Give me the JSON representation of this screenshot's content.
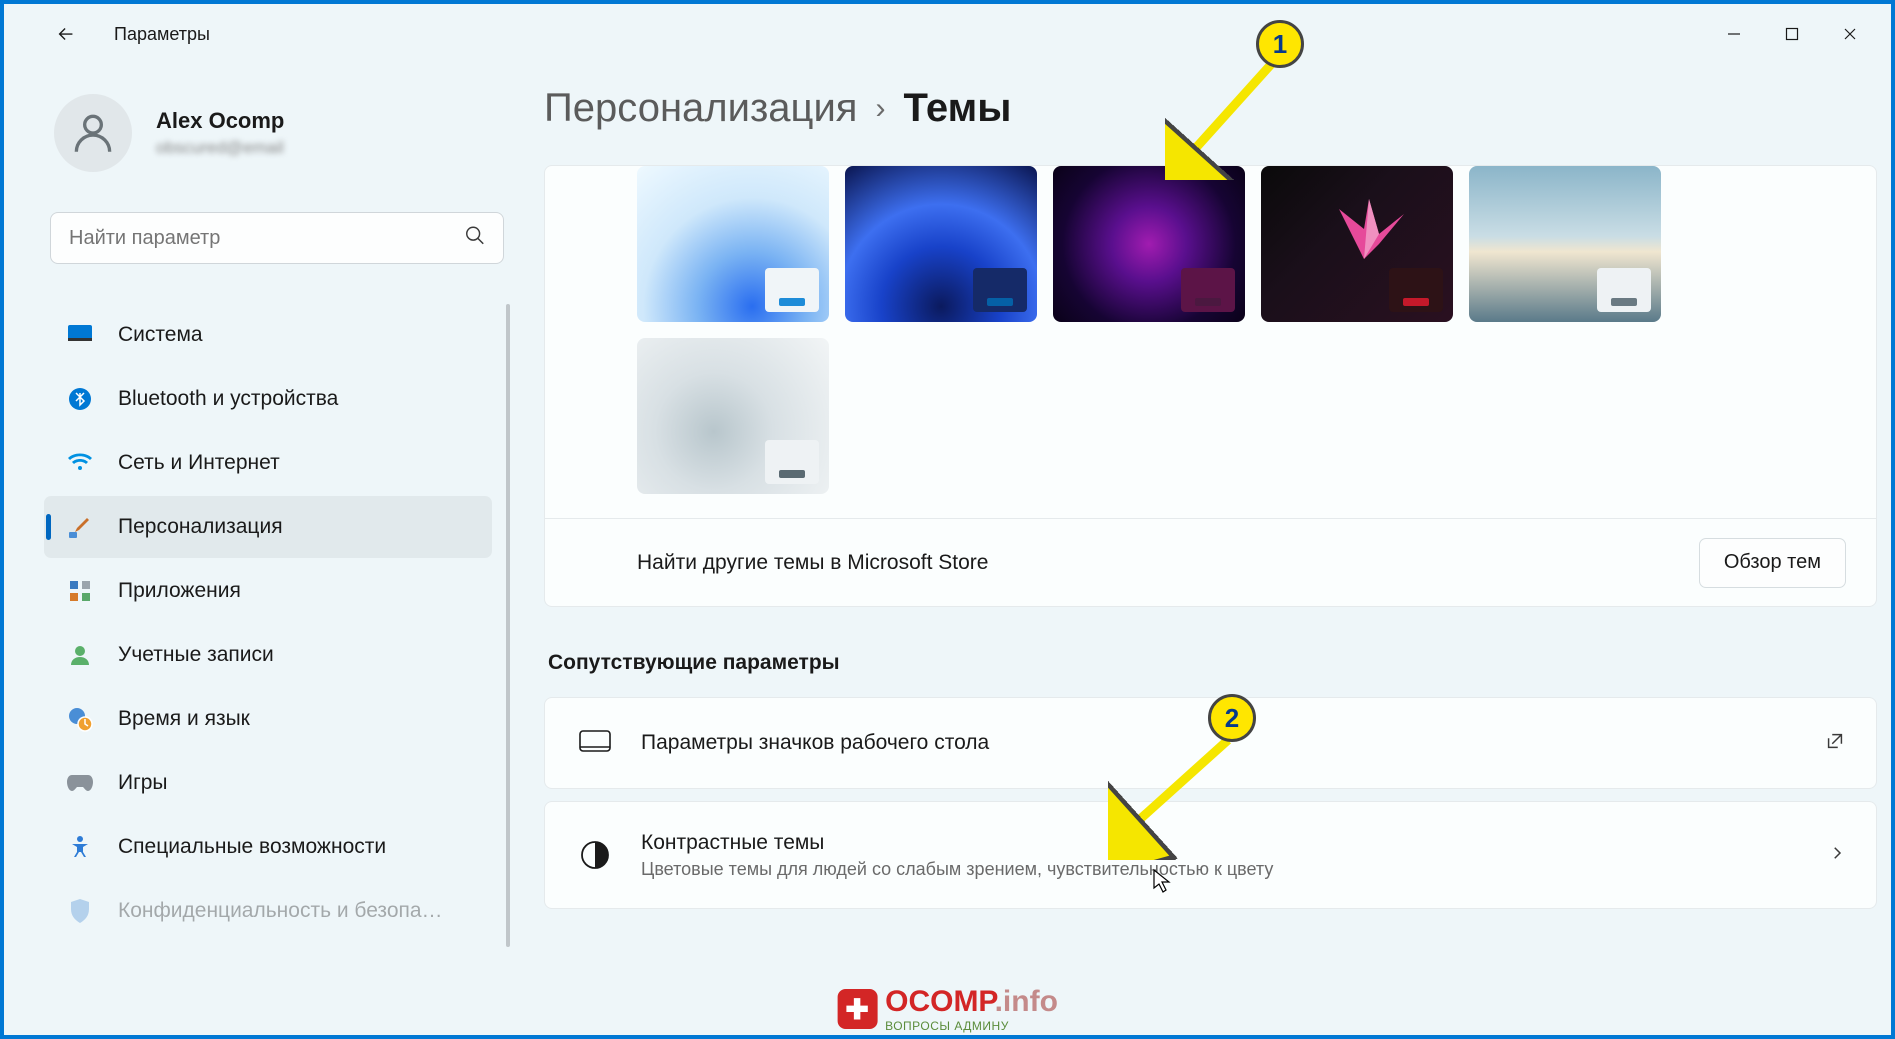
{
  "titlebar": {
    "title": "Параметры"
  },
  "user": {
    "name": "Alex Ocomp",
    "email": "obscured@email"
  },
  "search": {
    "placeholder": "Найти параметр"
  },
  "sidebar": {
    "items": [
      {
        "label": "Система"
      },
      {
        "label": "Bluetooth и устройства"
      },
      {
        "label": "Сеть и Интернет"
      },
      {
        "label": "Персонализация"
      },
      {
        "label": "Приложения"
      },
      {
        "label": "Учетные записи"
      },
      {
        "label": "Время и язык"
      },
      {
        "label": "Игры"
      },
      {
        "label": "Специальные возможности"
      },
      {
        "label": "Конфиденциальность и безопа…"
      }
    ]
  },
  "breadcrumb": {
    "parent": "Персонализация",
    "current": "Темы"
  },
  "themes": {
    "items": [
      {
        "bg_css": "radial-gradient(circle at 60% 90%, #2a6ef0 0%, #7ab3f3 30%, #cfe8fb 60%, #eef9ff 100%)",
        "accent_bg": "#f0f5f8",
        "accent_bar": "#1e8cd8"
      },
      {
        "bg_css": "radial-gradient(circle at 50% 90%, #0b1a5e 0%, #1842c9 35%, #3d6ff0 60%, #0a1550 100%)",
        "accent_bg": "#152a68",
        "accent_bar": "#0560a6"
      },
      {
        "bg_css": "radial-gradient(circle at 50% 50%, #a11cb0 0%, #5a0f8e 30%, #160433 70%, #0a0218 100%)",
        "accent_bg": "#5c1447",
        "accent_bar": "#4b1840"
      },
      {
        "bg_css": "linear-gradient(135deg, #0a0a0a 0%, #1a0f1a 40%, #2a1020 100%)",
        "accent_bg": "#2d1216",
        "accent_bar": "#c5192a",
        "overlay_flower": true
      },
      {
        "bg_css": "linear-gradient(180deg, #8bb5c9 0%, #c9dde5 45%, #f0e6d0 55%, #5a7a8a 100%)",
        "accent_bg": "#eef2f4",
        "accent_bar": "#6a7a82"
      },
      {
        "bg_css": "radial-gradient(circle at 40% 60%, #b8c6cc 0%, #d8e0e4 40%, #f2f5f6 100%)",
        "accent_bg": "#eef2f4",
        "accent_bar": "#5a6a72"
      }
    ],
    "store_text": "Найти другие темы в Microsoft Store",
    "store_btn": "Обзор тем"
  },
  "related": {
    "heading": "Сопутствующие параметры",
    "desktop_icons": {
      "title": "Параметры значков рабочего стола"
    },
    "contrast": {
      "title": "Контрастные темы",
      "subtitle": "Цветовые темы для людей со слабым зрением, чувствительностью к цвету"
    }
  },
  "annotations": {
    "badge1": "1",
    "badge2": "2"
  },
  "watermark": {
    "brand": "OCOMP",
    "suffix": ".info",
    "tagline": "ВОПРОСЫ АДМИНУ"
  }
}
